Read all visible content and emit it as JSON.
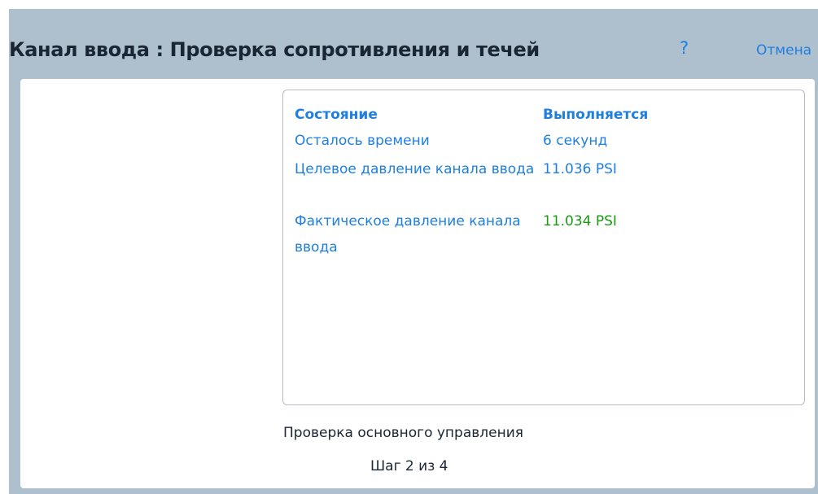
{
  "dialog": {
    "title": "Канал ввода : Проверка сопротивления и течей",
    "help_label": "?",
    "cancel_label": "Отмена"
  },
  "status": {
    "rows": [
      {
        "label": "Состояние",
        "value": "Выполняется"
      },
      {
        "label": "Осталось времени",
        "value": "6 секунд"
      },
      {
        "label": "Целевое давление канала ввода",
        "value": "11.036 PSI"
      },
      {
        "label": "Фактическое давление канала ввода",
        "value": "11.034 PSI"
      }
    ]
  },
  "footer": {
    "procedure": "Проверка основного управления",
    "step": "Шаг 2 из 4"
  },
  "colors": {
    "header_background": "#aebfcd",
    "accent": "#1f7fe0",
    "ok_value": "#1c9a14"
  }
}
